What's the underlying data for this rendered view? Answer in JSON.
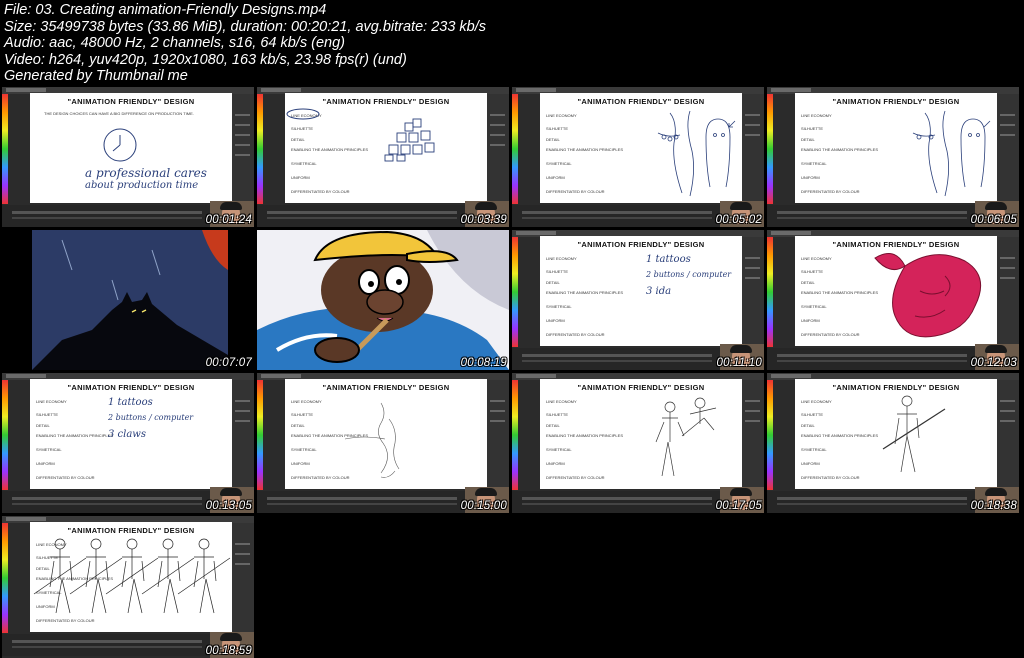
{
  "header": {
    "line1": "File: 03. Creating animation-Friendly Designs.mp4",
    "line2": "Size: 35499738 bytes (33.86 MiB), duration: 00:20:21, avg.bitrate: 233 kb/s",
    "line3": "Audio: aac, 48000 Hz, 2 channels, s16, 64 kb/s (eng)",
    "line4": "Video: h264, yuv420p, 1920x1080, 163 kb/s, 23.98 fps(r) (und)",
    "line5": "Generated by Thumbnail me"
  },
  "slide": {
    "title": "\"ANIMATION FRIENDLY\" DESIGN",
    "items": [
      "LINE ECONOMY",
      "SILHUETTE",
      "DETAIL",
      "ENABLING THE ANIMATION PRINCIPLES",
      "SYMETRICAL",
      "UNIFORM",
      "DIFFERENTIATED BY COLOUR"
    ],
    "first_text": "THE DESIGN CHOICES CAN HAVE A BIG DIFFERENCE ON PRODUCTION TIME."
  },
  "handwriting": {
    "t1_a": "a professional cares",
    "t1_b": "about production time",
    "list_1": "1 tattoos",
    "list_2": "2 buttons / computer",
    "list_3": "3 ida",
    "list_3b": "3 claws"
  },
  "thumbs": [
    {
      "ts": "00:01:24"
    },
    {
      "ts": "00:03:39"
    },
    {
      "ts": "00:05:02"
    },
    {
      "ts": "00:06:05"
    },
    {
      "ts": "00:07:07"
    },
    {
      "ts": "00:08:19"
    },
    {
      "ts": "00:11:10"
    },
    {
      "ts": "00:12:03"
    },
    {
      "ts": "00:13:05"
    },
    {
      "ts": "00:15:00"
    },
    {
      "ts": "00:17:05"
    },
    {
      "ts": "00:18:38"
    },
    {
      "ts": "00:18:59"
    }
  ],
  "colors": {
    "background": "#000000",
    "sketch": "#2a3f7a",
    "pink": "#d4235a",
    "app_dark": "#2b2b2b"
  }
}
